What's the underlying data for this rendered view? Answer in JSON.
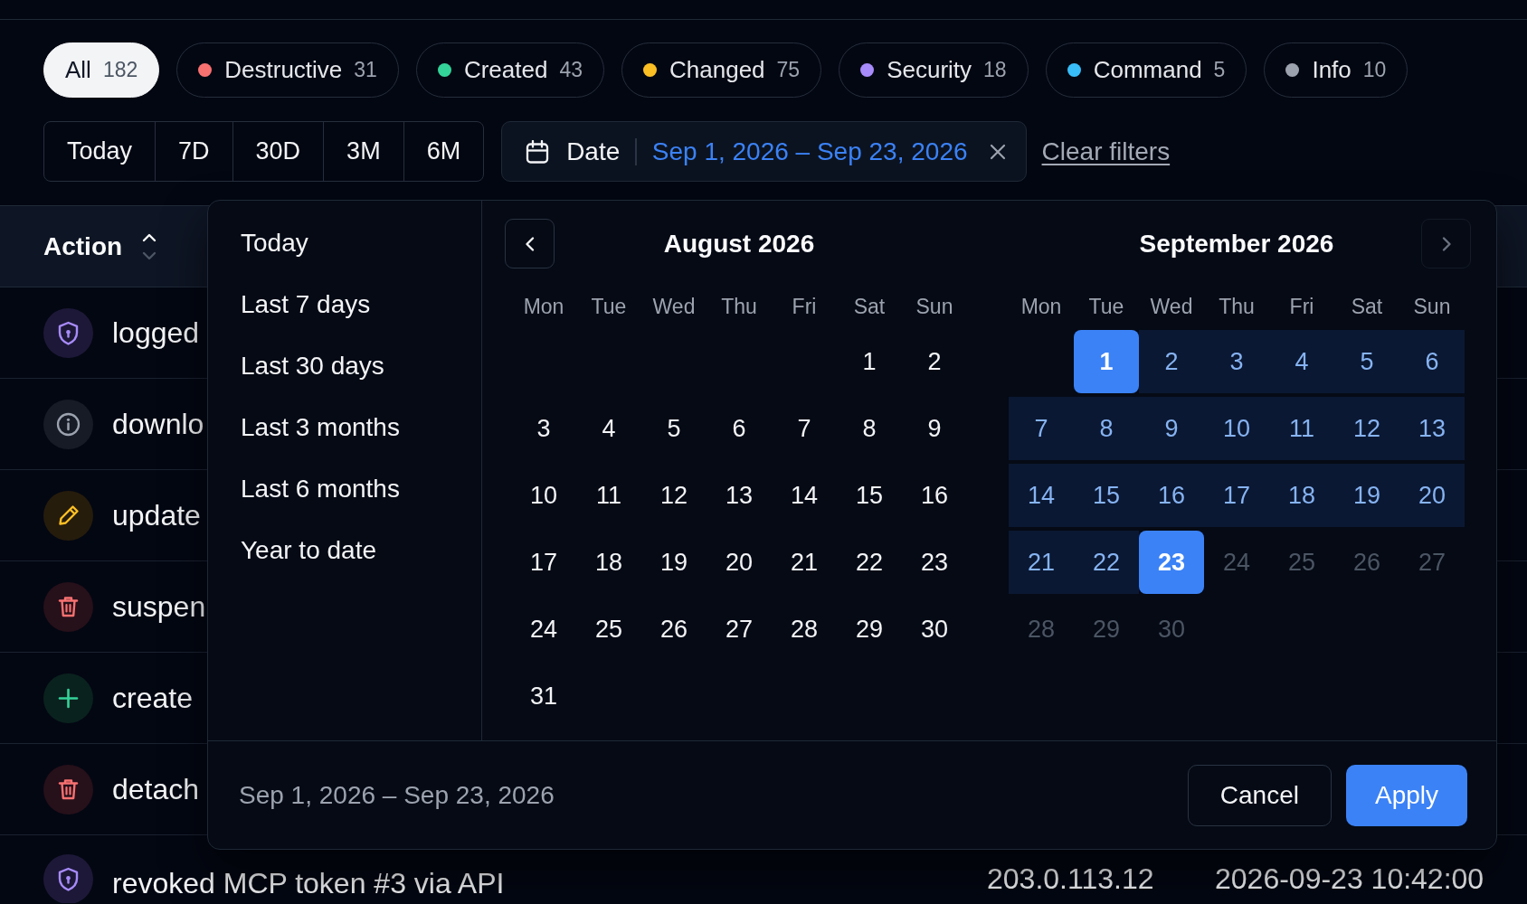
{
  "chips": [
    {
      "label": "All",
      "count": "182",
      "selected": true
    },
    {
      "label": "Destructive",
      "count": "31",
      "color": "#f87171",
      "selected": false
    },
    {
      "label": "Created",
      "count": "43",
      "color": "#34d399",
      "selected": false
    },
    {
      "label": "Changed",
      "count": "75",
      "color": "#fbbf24",
      "selected": false
    },
    {
      "label": "Security",
      "count": "18",
      "color": "#a78bfa",
      "selected": false
    },
    {
      "label": "Command",
      "count": "5",
      "color": "#38bdf8",
      "selected": false
    },
    {
      "label": "Info",
      "count": "10",
      "color": "#9ca3af",
      "selected": false
    }
  ],
  "ranges": [
    {
      "label": "Today",
      "selected": false
    },
    {
      "label": "7D",
      "selected": false
    },
    {
      "label": "30D",
      "selected": false
    },
    {
      "label": "3M",
      "selected": false
    },
    {
      "label": "6M",
      "selected": false
    }
  ],
  "date_filter": {
    "label": "Date",
    "value": "Sep 1, 2026 – Sep 23, 2026"
  },
  "clear_link": "Clear filters",
  "table": {
    "columns": [
      {
        "label": "Action",
        "sort_ascending": true
      }
    ],
    "rows": [
      {
        "kind": "security",
        "action": "logged"
      },
      {
        "kind": "info",
        "action": "downlo"
      },
      {
        "kind": "changed",
        "action": "update"
      },
      {
        "kind": "destructive",
        "action": "suspen"
      },
      {
        "kind": "created",
        "action": "create"
      },
      {
        "kind": "destructive",
        "action": "detach"
      },
      {
        "kind": "security",
        "action": "revoked MCP token #3 via API",
        "column_2": "203.0.113.12",
        "column_3": "2026-09-23 10:42:00"
      }
    ]
  },
  "date_picker": {
    "presets": [
      {
        "label": "Today",
        "selected": false
      },
      {
        "label": "Last 7 days",
        "selected": false
      },
      {
        "label": "Last 30 days",
        "selected": false
      },
      {
        "label": "Last 3 months",
        "selected": false
      },
      {
        "label": "Last 6 months",
        "selected": false
      },
      {
        "label": "Year to date",
        "selected": false
      }
    ],
    "previous_month": {
      "disabled": false
    },
    "next_month": {
      "disabled": true
    },
    "months": [
      {
        "title": "August 2026",
        "weekdays": [
          "Mon",
          "Tue",
          "Wed",
          "Thu",
          "Fri",
          "Sat",
          "Sun"
        ],
        "cells": [
          {
            "kind": "empty"
          },
          {
            "kind": "empty"
          },
          {
            "kind": "empty"
          },
          {
            "kind": "empty"
          },
          {
            "kind": "empty"
          },
          {
            "kind": "day",
            "label": "1",
            "selected": false,
            "in_range": false,
            "disabled": false
          },
          {
            "kind": "day",
            "label": "2",
            "selected": false,
            "in_range": false,
            "disabled": false
          },
          {
            "kind": "day",
            "label": "3",
            "selected": false,
            "in_range": false,
            "disabled": false
          },
          {
            "kind": "day",
            "label": "4",
            "selected": false,
            "in_range": false,
            "disabled": false
          },
          {
            "kind": "day",
            "label": "5",
            "selected": false,
            "in_range": false,
            "disabled": false
          },
          {
            "kind": "day",
            "label": "6",
            "selected": false,
            "in_range": false,
            "disabled": false
          },
          {
            "kind": "day",
            "label": "7",
            "selected": false,
            "in_range": false,
            "disabled": false
          },
          {
            "kind": "day",
            "label": "8",
            "selected": false,
            "in_range": false,
            "disabled": false
          },
          {
            "kind": "day",
            "label": "9",
            "selected": false,
            "in_range": false,
            "disabled": false
          },
          {
            "kind": "day",
            "label": "10",
            "selected": false,
            "in_range": false,
            "disabled": false
          },
          {
            "kind": "day",
            "label": "11",
            "selected": false,
            "in_range": false,
            "disabled": false
          },
          {
            "kind": "day",
            "label": "12",
            "selected": false,
            "in_range": false,
            "disabled": false
          },
          {
            "kind": "day",
            "label": "13",
            "selected": false,
            "in_range": false,
            "disabled": false
          },
          {
            "kind": "day",
            "label": "14",
            "selected": false,
            "in_range": false,
            "disabled": false
          },
          {
            "kind": "day",
            "label": "15",
            "selected": false,
            "in_range": false,
            "disabled": false
          },
          {
            "kind": "day",
            "label": "16",
            "selected": false,
            "in_range": false,
            "disabled": false
          },
          {
            "kind": "day",
            "label": "17",
            "selected": false,
            "in_range": false,
            "disabled": false
          },
          {
            "kind": "day",
            "label": "18",
            "selected": false,
            "in_range": false,
            "disabled": false
          },
          {
            "kind": "day",
            "label": "19",
            "selected": false,
            "in_range": false,
            "disabled": false
          },
          {
            "kind": "day",
            "label": "20",
            "selected": false,
            "in_range": false,
            "disabled": false
          },
          {
            "kind": "day",
            "label": "21",
            "selected": false,
            "in_range": false,
            "disabled": false
          },
          {
            "kind": "day",
            "label": "22",
            "selected": false,
            "in_range": false,
            "disabled": false
          },
          {
            "kind": "day",
            "label": "23",
            "selected": false,
            "in_range": false,
            "disabled": false
          },
          {
            "kind": "day",
            "label": "24",
            "selected": false,
            "in_range": false,
            "disabled": false
          },
          {
            "kind": "day",
            "label": "25",
            "selected": false,
            "in_range": false,
            "disabled": false
          },
          {
            "kind": "day",
            "label": "26",
            "selected": false,
            "in_range": false,
            "disabled": false
          },
          {
            "kind": "day",
            "label": "27",
            "selected": false,
            "in_range": false,
            "disabled": false
          },
          {
            "kind": "day",
            "label": "28",
            "selected": false,
            "in_range": false,
            "disabled": false
          },
          {
            "kind": "day",
            "label": "29",
            "selected": false,
            "in_range": false,
            "disabled": false
          },
          {
            "kind": "day",
            "label": "30",
            "selected": false,
            "in_range": false,
            "disabled": false
          },
          {
            "kind": "day",
            "label": "31",
            "selected": false,
            "in_range": false,
            "disabled": false
          }
        ]
      },
      {
        "title": "September 2026",
        "weekdays": [
          "Mon",
          "Tue",
          "Wed",
          "Thu",
          "Fri",
          "Sat",
          "Sun"
        ],
        "cells": [
          {
            "kind": "empty"
          },
          {
            "kind": "day",
            "label": "1",
            "selected": true,
            "in_range": false,
            "disabled": false
          },
          {
            "kind": "day",
            "label": "2",
            "selected": false,
            "in_range": true,
            "disabled": false
          },
          {
            "kind": "day",
            "label": "3",
            "selected": false,
            "in_range": true,
            "disabled": false
          },
          {
            "kind": "day",
            "label": "4",
            "selected": false,
            "in_range": true,
            "disabled": false
          },
          {
            "kind": "day",
            "label": "5",
            "selected": false,
            "in_range": true,
            "disabled": false
          },
          {
            "kind": "day",
            "label": "6",
            "selected": false,
            "in_range": true,
            "disabled": false
          },
          {
            "kind": "day",
            "label": "7",
            "selected": false,
            "in_range": true,
            "disabled": false
          },
          {
            "kind": "day",
            "label": "8",
            "selected": false,
            "in_range": true,
            "disabled": false
          },
          {
            "kind": "day",
            "label": "9",
            "selected": false,
            "in_range": true,
            "disabled": false
          },
          {
            "kind": "day",
            "label": "10",
            "selected": false,
            "in_range": true,
            "disabled": false
          },
          {
            "kind": "day",
            "label": "11",
            "selected": false,
            "in_range": true,
            "disabled": false
          },
          {
            "kind": "day",
            "label": "12",
            "selected": false,
            "in_range": true,
            "disabled": false
          },
          {
            "kind": "day",
            "label": "13",
            "selected": false,
            "in_range": true,
            "disabled": false
          },
          {
            "kind": "day",
            "label": "14",
            "selected": false,
            "in_range": true,
            "disabled": false
          },
          {
            "kind": "day",
            "label": "15",
            "selected": false,
            "in_range": true,
            "disabled": false
          },
          {
            "kind": "day",
            "label": "16",
            "selected": false,
            "in_range": true,
            "disabled": false
          },
          {
            "kind": "day",
            "label": "17",
            "selected": false,
            "in_range": true,
            "disabled": false
          },
          {
            "kind": "day",
            "label": "18",
            "selected": false,
            "in_range": true,
            "disabled": false
          },
          {
            "kind": "day",
            "label": "19",
            "selected": false,
            "in_range": true,
            "disabled": false
          },
          {
            "kind": "day",
            "label": "20",
            "selected": false,
            "in_range": true,
            "disabled": false
          },
          {
            "kind": "day",
            "label": "21",
            "selected": false,
            "in_range": true,
            "disabled": false
          },
          {
            "kind": "day",
            "label": "22",
            "selected": false,
            "in_range": true,
            "disabled": false
          },
          {
            "kind": "day",
            "label": "23",
            "selected": true,
            "in_range": false,
            "disabled": false
          },
          {
            "kind": "day",
            "label": "24",
            "selected": false,
            "in_range": false,
            "disabled": true
          },
          {
            "kind": "day",
            "label": "25",
            "selected": false,
            "in_range": false,
            "disabled": true
          },
          {
            "kind": "day",
            "label": "26",
            "selected": false,
            "in_range": false,
            "disabled": true
          },
          {
            "kind": "day",
            "label": "27",
            "selected": false,
            "in_range": false,
            "disabled": true
          },
          {
            "kind": "day",
            "label": "28",
            "selected": false,
            "in_range": false,
            "disabled": true
          },
          {
            "kind": "day",
            "label": "29",
            "selected": false,
            "in_range": false,
            "disabled": true
          },
          {
            "kind": "day",
            "label": "30",
            "selected": false,
            "in_range": false,
            "disabled": true
          }
        ]
      }
    ],
    "summary": "Sep 1, 2026 – Sep 23, 2026",
    "buttons": [
      {
        "label": "Cancel",
        "kind": "secondary"
      },
      {
        "label": "Apply",
        "kind": "primary"
      }
    ]
  }
}
